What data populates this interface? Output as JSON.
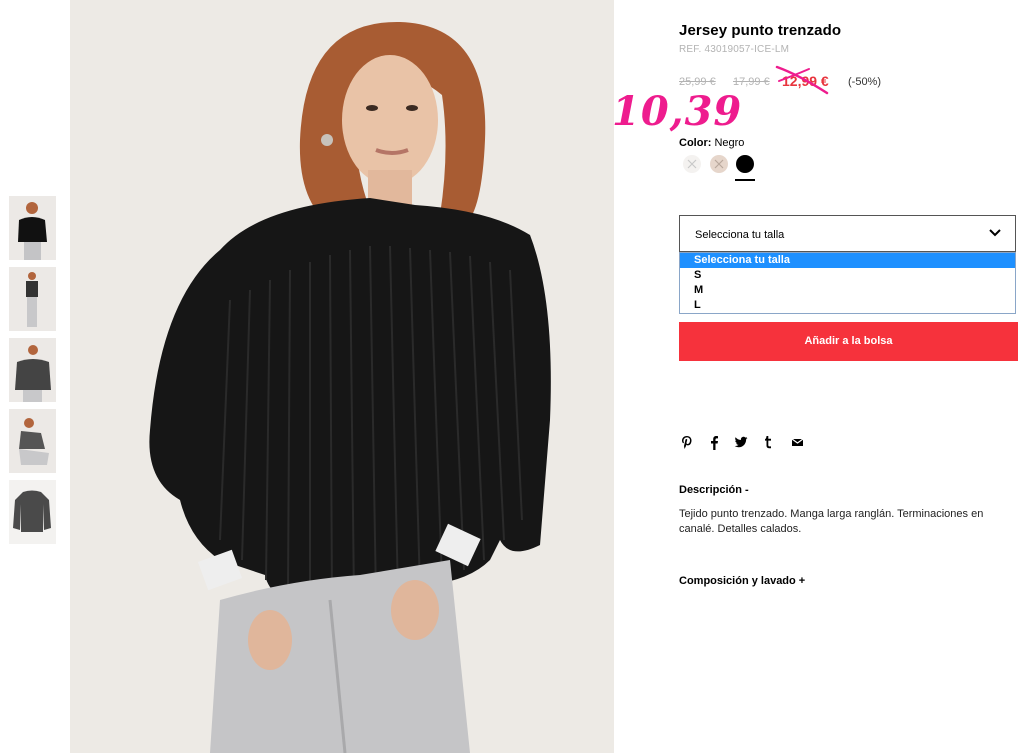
{
  "product": {
    "title": "Jersey punto trenzado",
    "ref": "REF. 43019057-ICE-LM",
    "price_original": "25,99 €",
    "price_previous": "17,99 €",
    "price_sale": "12,99 €",
    "discount": "(-50%)",
    "handwritten_price": "10,39",
    "color_label": "Color:",
    "color_value": "Negro",
    "swatch_colors": [
      "#f4f2f0",
      "#e6d6cb",
      "#000000"
    ],
    "size_select_label": "Selecciona tu talla",
    "size_options": [
      "Selecciona tu talla",
      "S",
      "M",
      "L"
    ],
    "add_to_bag": "Añadir a la bolsa",
    "description_heading": "Descripción  -",
    "description_text": "Tejido punto trenzado. Manga larga ranglán. Terminaciones en canalé. Detalles calados.",
    "composition_heading": "Composición y lavado  +"
  },
  "share_icons": [
    "pinterest-icon",
    "facebook-icon",
    "twitter-icon",
    "tumblr-icon",
    "mail-icon"
  ],
  "colors": {
    "accent": "#f6323c",
    "sale": "#e8343d",
    "handwritten": "#ee1c8e",
    "selected_option": "#1e90ff"
  }
}
